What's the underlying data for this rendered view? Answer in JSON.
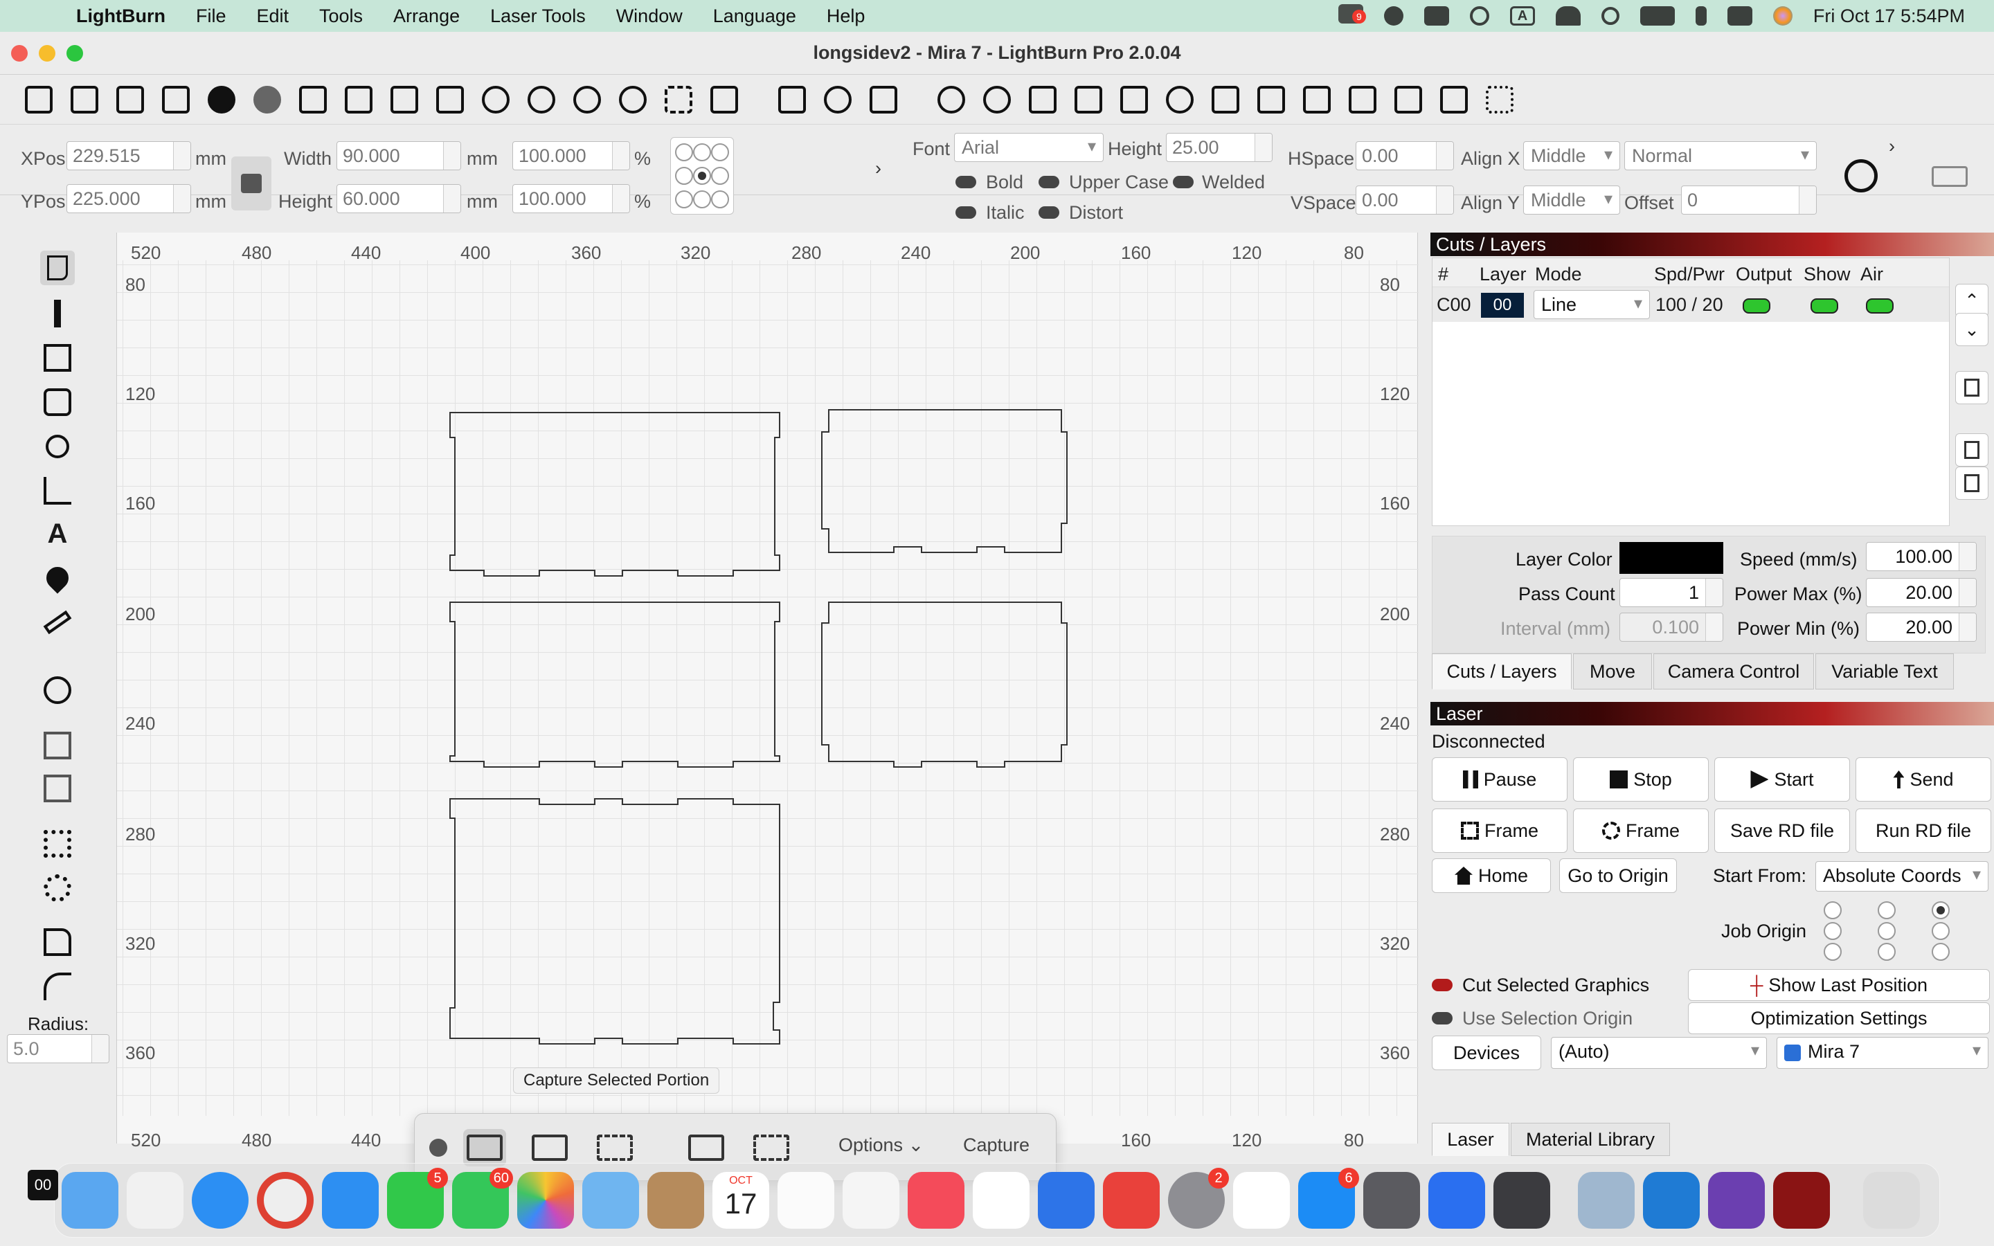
{
  "menubar": {
    "app_name": "LightBurn",
    "items": [
      "File",
      "Edit",
      "Tools",
      "Arrange",
      "Laser Tools",
      "Window",
      "Language",
      "Help"
    ],
    "status_badge": "9",
    "input_source": "A",
    "clock": "Fri Oct 17  5:54PM"
  },
  "window": {
    "title": "longsidev2 - Mira 7 - LightBurn Pro 2.0.04"
  },
  "props": {
    "xpos_label": "XPos",
    "xpos_value": "229.515",
    "xpos_unit": "mm",
    "ypos_label": "YPos",
    "ypos_value": "225.000",
    "ypos_unit": "mm",
    "width_label": "Width",
    "width_value": "90.000",
    "width_unit": "mm",
    "width_pct": "100.000",
    "pct": "%",
    "height_label": "Height",
    "height_value": "60.000",
    "height_unit": "mm",
    "height_pct": "100.000",
    "font_label": "Font",
    "font_value": "Arial",
    "font_height_label": "Height",
    "font_height_value": "25.00",
    "bold": "Bold",
    "upper_case": "Upper Case",
    "welded": "Welded",
    "italic": "Italic",
    "distort": "Distort",
    "hspace_label": "HSpace",
    "hspace_value": "0.00",
    "vspace_label": "VSpace",
    "vspace_value": "0.00",
    "alignx_label": "Align X",
    "alignx_value": "Middle",
    "aligny_label": "Align Y",
    "aligny_value": "Middle",
    "style_value": "Normal",
    "offset_label": "Offset",
    "offset_value": "0"
  },
  "left_palette": {
    "radius_label": "Radius:",
    "radius_value": "5.0"
  },
  "canvas": {
    "top_ruler": [
      "520",
      "480",
      "440",
      "400",
      "360",
      "320",
      "280",
      "240",
      "200",
      "160",
      "120",
      "80"
    ],
    "bottom_ruler": [
      "520",
      "480",
      "440",
      "160",
      "120",
      "80"
    ],
    "left_ruler": [
      "80",
      "120",
      "160",
      "200",
      "240",
      "280",
      "320",
      "360"
    ],
    "right_ruler": [
      "80",
      "120",
      "160",
      "200",
      "240",
      "280",
      "320",
      "360"
    ],
    "tooltip": "Capture Selected Portion"
  },
  "cuts": {
    "header": "Cuts / Layers",
    "columns": [
      "#",
      "Layer",
      "Mode",
      "Spd/Pwr",
      "Output",
      "Show",
      "Air"
    ],
    "row": {
      "id": "C00",
      "layer": "00",
      "mode": "Line",
      "spd_pwr": "100 / 20"
    },
    "layer_color_label": "Layer Color",
    "layer_color": "#000000",
    "pass_count_label": "Pass Count",
    "pass_count": "1",
    "interval_label": "Interval (mm)",
    "interval": "0.100",
    "speed_label": "Speed (mm/s)",
    "speed": "100.00",
    "power_max_label": "Power Max (%)",
    "power_max": "20.00",
    "power_min_label": "Power Min (%)",
    "power_min": "20.00",
    "tabs": [
      "Cuts / Layers",
      "Move",
      "Camera Control",
      "Variable Text"
    ]
  },
  "laser": {
    "header": "Laser",
    "status": "Disconnected",
    "pause": "Pause",
    "stop": "Stop",
    "start": "Start",
    "send": "Send",
    "frame1": "Frame",
    "frame2": "Frame",
    "save_rd": "Save RD file",
    "run_rd": "Run RD file",
    "home": "Home",
    "go_origin": "Go to Origin",
    "start_from_label": "Start From:",
    "start_from_value": "Absolute Coords",
    "job_origin_label": "Job Origin",
    "cut_selected": "Cut Selected Graphics",
    "show_last": "Show Last Position",
    "use_selection": "Use Selection Origin",
    "optimization": "Optimization Settings",
    "devices": "Devices",
    "port_value": "(Auto)",
    "device_value": "Mira 7",
    "bottom_tabs": [
      "Laser",
      "Material Library"
    ]
  },
  "capture_toolbar": {
    "options": "Options",
    "capture": "Capture"
  },
  "dock": {
    "left_partial": "00",
    "messages_badge": "60",
    "facetime_badge": "5",
    "settings_badge": "2",
    "appstore_badge": "6",
    "calendar_month": "OCT",
    "calendar_day": "17"
  },
  "colors": {
    "menubar_bg": "#c7e6d8",
    "panel_header_gradient": [
      "#111111",
      "#b42020",
      "#d9a596"
    ],
    "toggle_on": "#2ec52e",
    "toggle_red": "#b21b1b"
  }
}
